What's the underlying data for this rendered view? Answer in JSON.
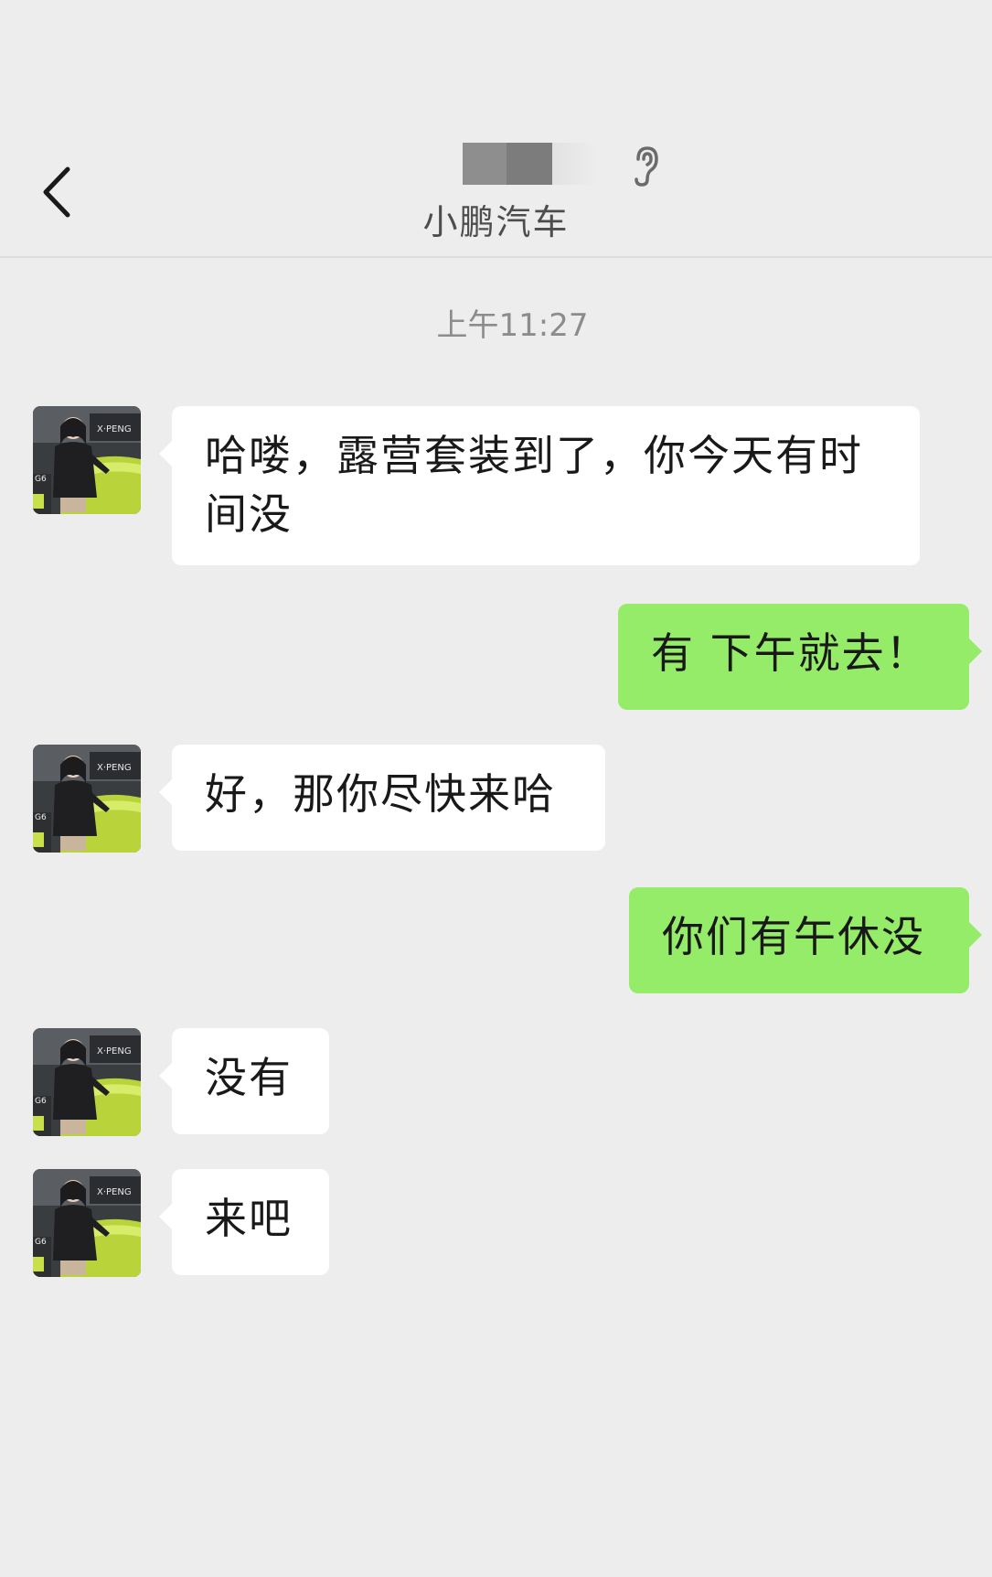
{
  "header": {
    "back_icon": "chevron-left-icon",
    "contact_name_blurred": true,
    "status_icon": "ear-icon",
    "subtitle": "小鹏汽车"
  },
  "chat": {
    "timestamp": "上午11:27",
    "messages": [
      {
        "from": "contact",
        "text": "哈喽，露营套装到了，你今天有时间没"
      },
      {
        "from": "me",
        "text": "有 下午就去！"
      },
      {
        "from": "contact",
        "text": "好，那你尽快来哈"
      },
      {
        "from": "me",
        "text": "你们有午休没"
      },
      {
        "from": "contact",
        "text": "没有"
      },
      {
        "from": "contact",
        "text": "来吧"
      }
    ]
  },
  "colors": {
    "background": "#ededed",
    "incoming_bubble": "#ffffff",
    "outgoing_bubble": "#95ec69",
    "timestamp_text": "#8c8c8c",
    "subtitle_text": "#4d4d4d"
  }
}
